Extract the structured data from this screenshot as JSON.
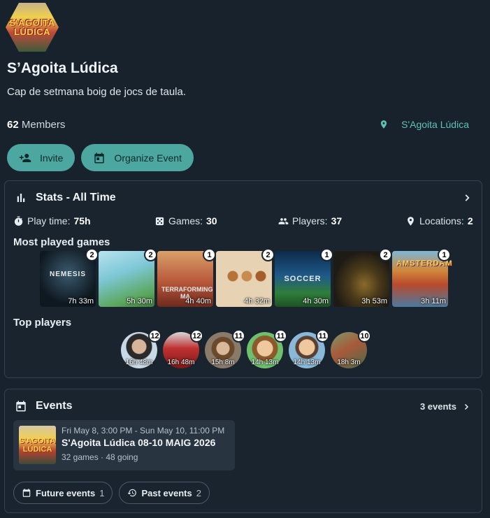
{
  "group": {
    "logo_text_1": "S'AGOITA",
    "logo_text_2": "LÚDICA",
    "title": "S’Agoita Lúdica",
    "description": "Cap de setmana boig de jocs de taula.",
    "members_count": "62",
    "members_label": "Members",
    "location": "S'Agoita Lúdica"
  },
  "actions": {
    "invite_label": "Invite",
    "organize_label": "Organize Event"
  },
  "stats": {
    "title": "Stats - All Time",
    "playtime_label": "Play time:",
    "playtime_value": "75h",
    "games_label": "Games:",
    "games_value": "30",
    "players_label": "Players:",
    "players_value": "37",
    "locations_label": "Locations:",
    "locations_value": "2",
    "most_played_title": "Most played games",
    "games": [
      {
        "count": "2",
        "time": "7h 33m",
        "label": "NEMESIS"
      },
      {
        "count": "2",
        "time": "5h 30m",
        "label": ""
      },
      {
        "count": "1",
        "time": "4h 40m",
        "label": "TERRAFORMING MA"
      },
      {
        "count": "2",
        "time": "4h 32m",
        "label": ""
      },
      {
        "count": "1",
        "time": "4h 30m",
        "label": "SOCCER"
      },
      {
        "count": "2",
        "time": "3h 53m",
        "label": ""
      },
      {
        "count": "1",
        "time": "3h 11m",
        "label": "AMSTERDAM"
      }
    ],
    "top_players_title": "Top players",
    "players": [
      {
        "count": "12",
        "time": "16h 48m"
      },
      {
        "count": "12",
        "time": "16h 48m"
      },
      {
        "count": "11",
        "time": "15h 8m"
      },
      {
        "count": "11",
        "time": "14h 13m"
      },
      {
        "count": "11",
        "time": "14h 13m"
      },
      {
        "count": "10",
        "time": "18h 3m"
      }
    ]
  },
  "events": {
    "title": "Events",
    "count_label": "3 events",
    "item": {
      "thumb_text_1": "S'AGOITA",
      "thumb_text_2": "LÚDICA",
      "date": "Fri May 8, 3:00 PM - Sun May 10, 11:00 PM",
      "name": "S'Agoita Lúdica 08-10 MAIG 2026",
      "meta": "32 games · 48 going"
    },
    "future_label": "Future events",
    "future_count": "1",
    "past_label": "Past events",
    "past_count": "2"
  },
  "colors": {
    "background": "#18222c",
    "accent": "#4ca7a1",
    "location_text": "#5fc2b7"
  }
}
